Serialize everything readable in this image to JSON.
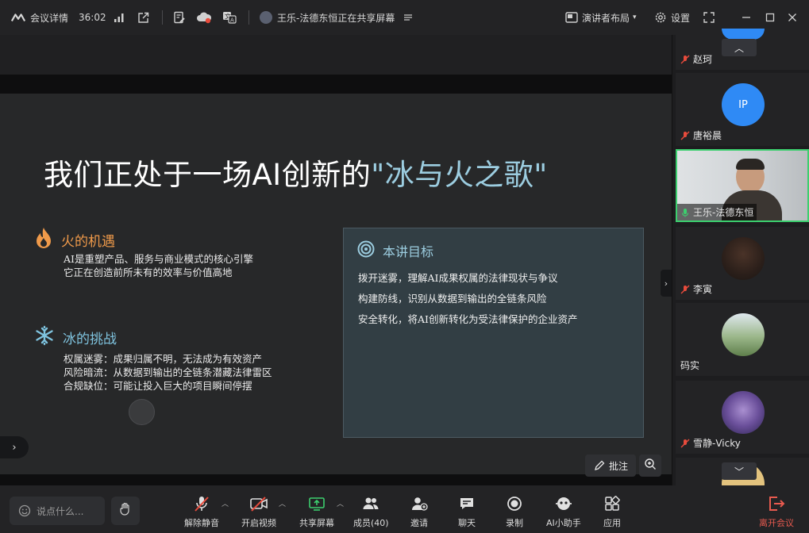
{
  "topbar": {
    "meeting_details": "会议详情",
    "duration": "36:02",
    "share_notice": "王乐-法德东恒正在共享屏幕",
    "layout_label": "演讲者布局",
    "settings_label": "设置"
  },
  "slide": {
    "title_main": "我们正处于一场AI创新的",
    "title_highlight": "\"冰与火之歌\"",
    "fire": {
      "heading": "火的机遇",
      "lines": [
        "AI是重塑产品、服务与商业模式的核心引擎",
        "它正在创造前所未有的效率与价值高地"
      ]
    },
    "ice": {
      "heading": "冰的挑战",
      "lines": [
        "权属迷雾：成果归属不明，无法成为有效资产",
        "风险暗流：从数据到输出的全链条潜藏法律雷区",
        "合规缺位：可能让投入巨大的项目瞬间停摆"
      ]
    },
    "goals": {
      "heading": "本讲目标",
      "lines": [
        "拨开迷雾，理解AI成果权属的法律现状与争议",
        "构建防线，识别从数据到输出的全链条风险",
        "安全转化，将AI创新转化为受法律保护的企业资产"
      ]
    }
  },
  "annotate_label": "批注",
  "participants": [
    {
      "name": "赵珂",
      "muted": true
    },
    {
      "name": "唐裕晨",
      "muted": true,
      "initials": "IP"
    },
    {
      "name": "王乐-法德东恒",
      "muted": false,
      "speaking": true
    },
    {
      "name": "李寅",
      "muted": true
    },
    {
      "name": "码实",
      "muted": false
    },
    {
      "name": "雪静-Vicky",
      "muted": true
    }
  ],
  "toolbar": {
    "say_placeholder": "说点什么...",
    "unmute": "解除静音",
    "start_video": "开启视频",
    "share_screen": "共享屏幕",
    "members": "成员(40)",
    "invite": "邀请",
    "chat": "聊天",
    "record": "录制",
    "ai_assistant": "AI小助手",
    "apps": "应用",
    "leave": "离开会议"
  },
  "colors": {
    "accent_fire": "#ef9a4a",
    "accent_ice": "#7fc3de",
    "leave": "#e85a4f",
    "speaking_border": "#3ccf6e",
    "avatar_ip": "#2f8af5"
  }
}
